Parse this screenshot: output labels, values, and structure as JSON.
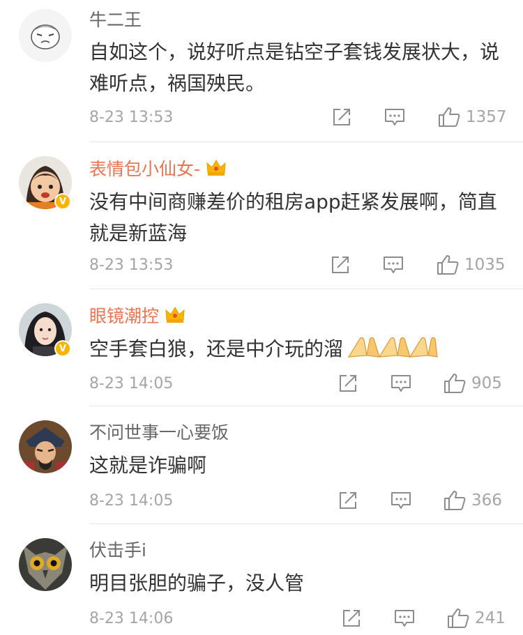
{
  "comments": [
    {
      "name": "牛二王",
      "text": "自如这个，说好听点是钻空子套钱发展状大，说难听点，祸国殃民。",
      "time": "8-23 13:53",
      "likes": "1357",
      "avatar": "cartoon-avatar",
      "verified": false,
      "vip": false
    },
    {
      "name": "表情包小仙女-",
      "text": "没有中间商赚差价的租房app赶紧发展啊，简直就是新蓝海",
      "time": "8-23 13:53",
      "likes": "1035",
      "avatar": "girl-cartoon-avatar",
      "verified": true,
      "vip": true
    },
    {
      "name": "眼镜潮控",
      "text": "空手套白狼，还是中介玩的溜",
      "time": "8-23 14:05",
      "likes": "905",
      "avatar": "woman-photo-avatar",
      "verified": true,
      "vip": true,
      "emoji": "pray-hands-emoji",
      "emoji_count": 3
    },
    {
      "name": "不问世事一心要饭",
      "text": "这就是诈骗啊",
      "time": "8-23 14:05",
      "likes": "366",
      "avatar": "opera-figure-avatar",
      "verified": false,
      "vip": false
    },
    {
      "name": "伏击手i",
      "text": "明目张胆的骗子，没人管",
      "time": "8-23 14:06",
      "likes": "241",
      "avatar": "owl-avatar",
      "verified": false,
      "vip": false
    }
  ],
  "icons": {
    "share": "share-icon",
    "reply": "comment-icon",
    "like": "thumbs-up-icon",
    "crown": "vip-crown-icon",
    "verified": "verified-v-icon"
  },
  "colors": {
    "vip_name": "#eb7350",
    "normal_name": "#666666",
    "meta": "#a5a5a5",
    "badge": "#f7b500"
  }
}
